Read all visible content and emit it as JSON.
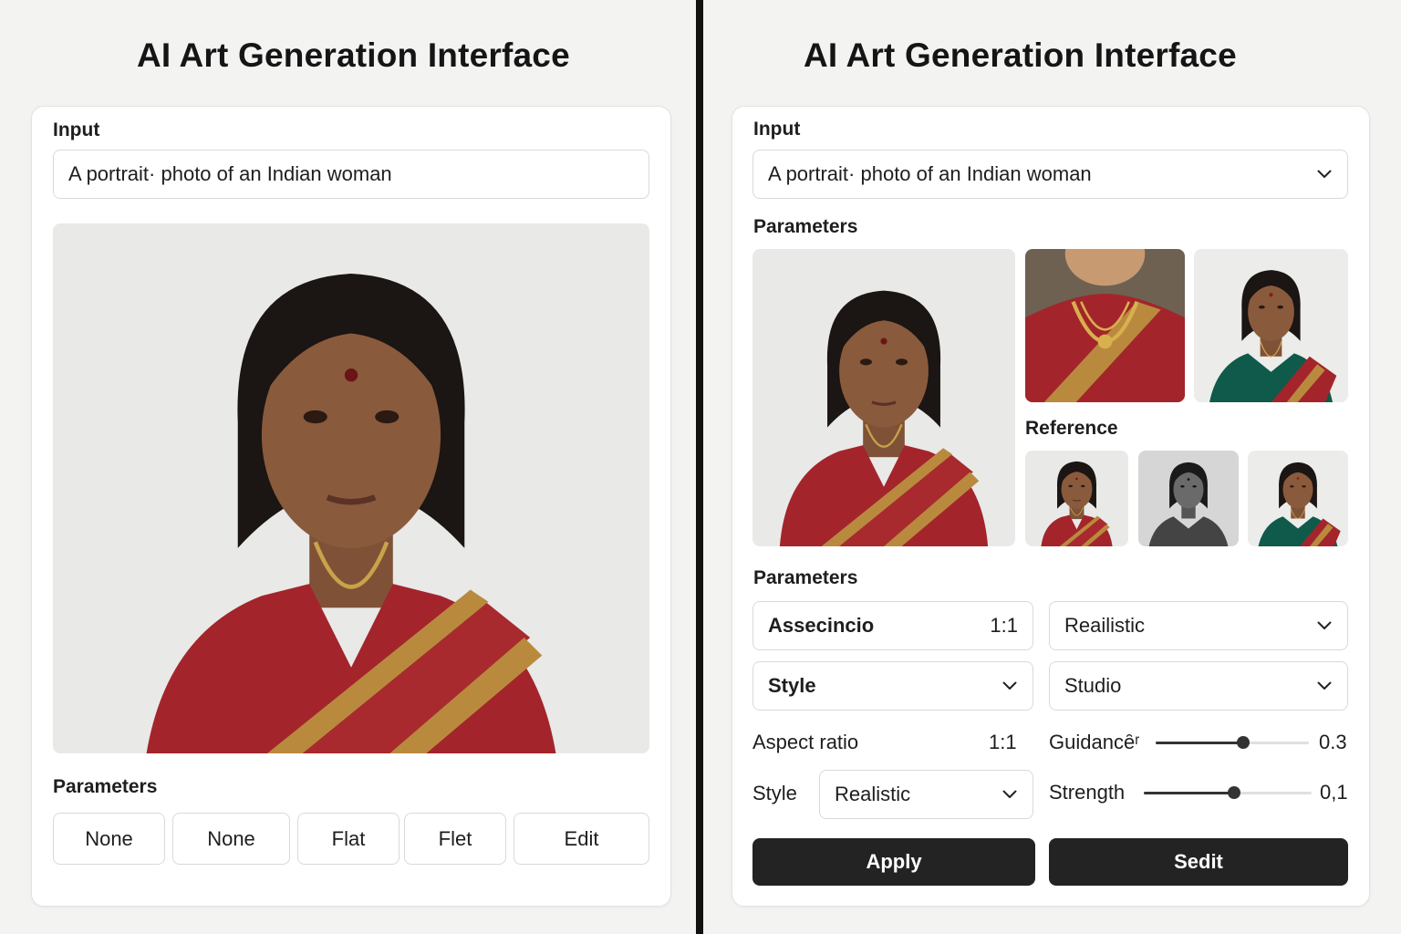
{
  "left": {
    "title": "AI Art Generation Interface",
    "input_label": "Input",
    "prompt_value": "A portrait· photo of an Indian woman",
    "params_label": "Parameters",
    "buttons": [
      "None",
      "None",
      "Flat",
      "Flet",
      "Edit"
    ]
  },
  "right": {
    "title": "AI Art Generation Interface",
    "input_label": "Input",
    "prompt_value": "A portrait· photo of an Indian woman",
    "params_label_top": "Parameters",
    "reference_label": "Reference",
    "params_label_bottom": "Parameters",
    "assecincio": {
      "label": "Assecincio",
      "ratio": "1:1"
    },
    "style_select": {
      "label": "Style"
    },
    "realistic_select": {
      "value": "Reailistic"
    },
    "studio_select": {
      "value": "Studio"
    },
    "aspect_ratio": {
      "label": "Aspect ratio",
      "value": "1:1"
    },
    "style_row": {
      "label": "Style",
      "value": "Realistic"
    },
    "guidance": {
      "label": "Guidancȇʳ",
      "value": "0.3",
      "level": 0.57
    },
    "strength": {
      "label": "Strength",
      "value": "0,1",
      "level": 0.54
    },
    "apply_label": "Apply",
    "sedit_label": "Sedit"
  },
  "icons": [
    "chevron-down-icon"
  ],
  "colors": {
    "saree_red": "#a3252b",
    "saree_gold": "#b98a3e",
    "dark_button": "#232323",
    "skin": "#8a5a3c"
  }
}
